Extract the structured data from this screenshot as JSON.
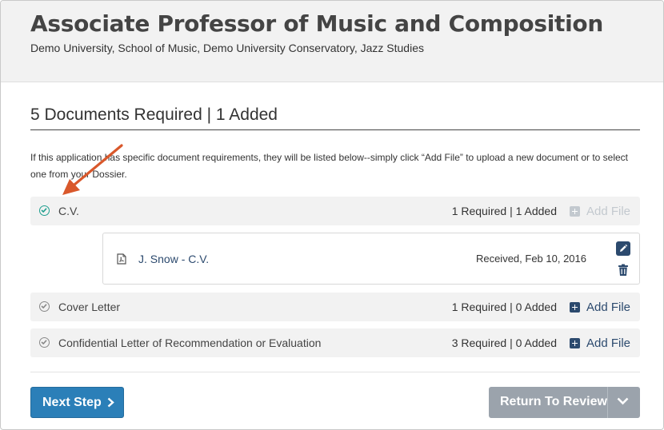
{
  "job": {
    "title": "Associate Professor of Music and Composition",
    "subtitle": "Demo University, School of Music, Demo University Conservatory, Jazz Studies"
  },
  "documents": {
    "heading": "5 Documents Required | 1 Added",
    "intro": "If this application has specific document requirements, they will be listed below--simply click “Add File” to upload a new document or to select one from your Dossier.",
    "add_file_label": "Add File",
    "items": [
      {
        "name": "C.V.",
        "count": "1 Required | 1 Added",
        "complete": true
      },
      {
        "name": "Cover Letter",
        "count": "1 Required | 0 Added",
        "complete": false
      },
      {
        "name": "Confidential Letter of Recommendation or Evaluation",
        "count": "3 Required | 0 Added",
        "complete": false
      }
    ],
    "cv_file": {
      "name": "J. Snow - C.V.",
      "received": "Received, Feb 10, 2016",
      "icon": "pdf-file-icon"
    }
  },
  "footer": {
    "next_label": "Next Step",
    "review_label": "Return To Review"
  },
  "colors": {
    "accent": "#2b7fb8",
    "link": "#2c4a6e",
    "complete": "#1e9e8e",
    "annotation_arrow": "#d9582b",
    "disabled_button": "#9ba3ac"
  }
}
